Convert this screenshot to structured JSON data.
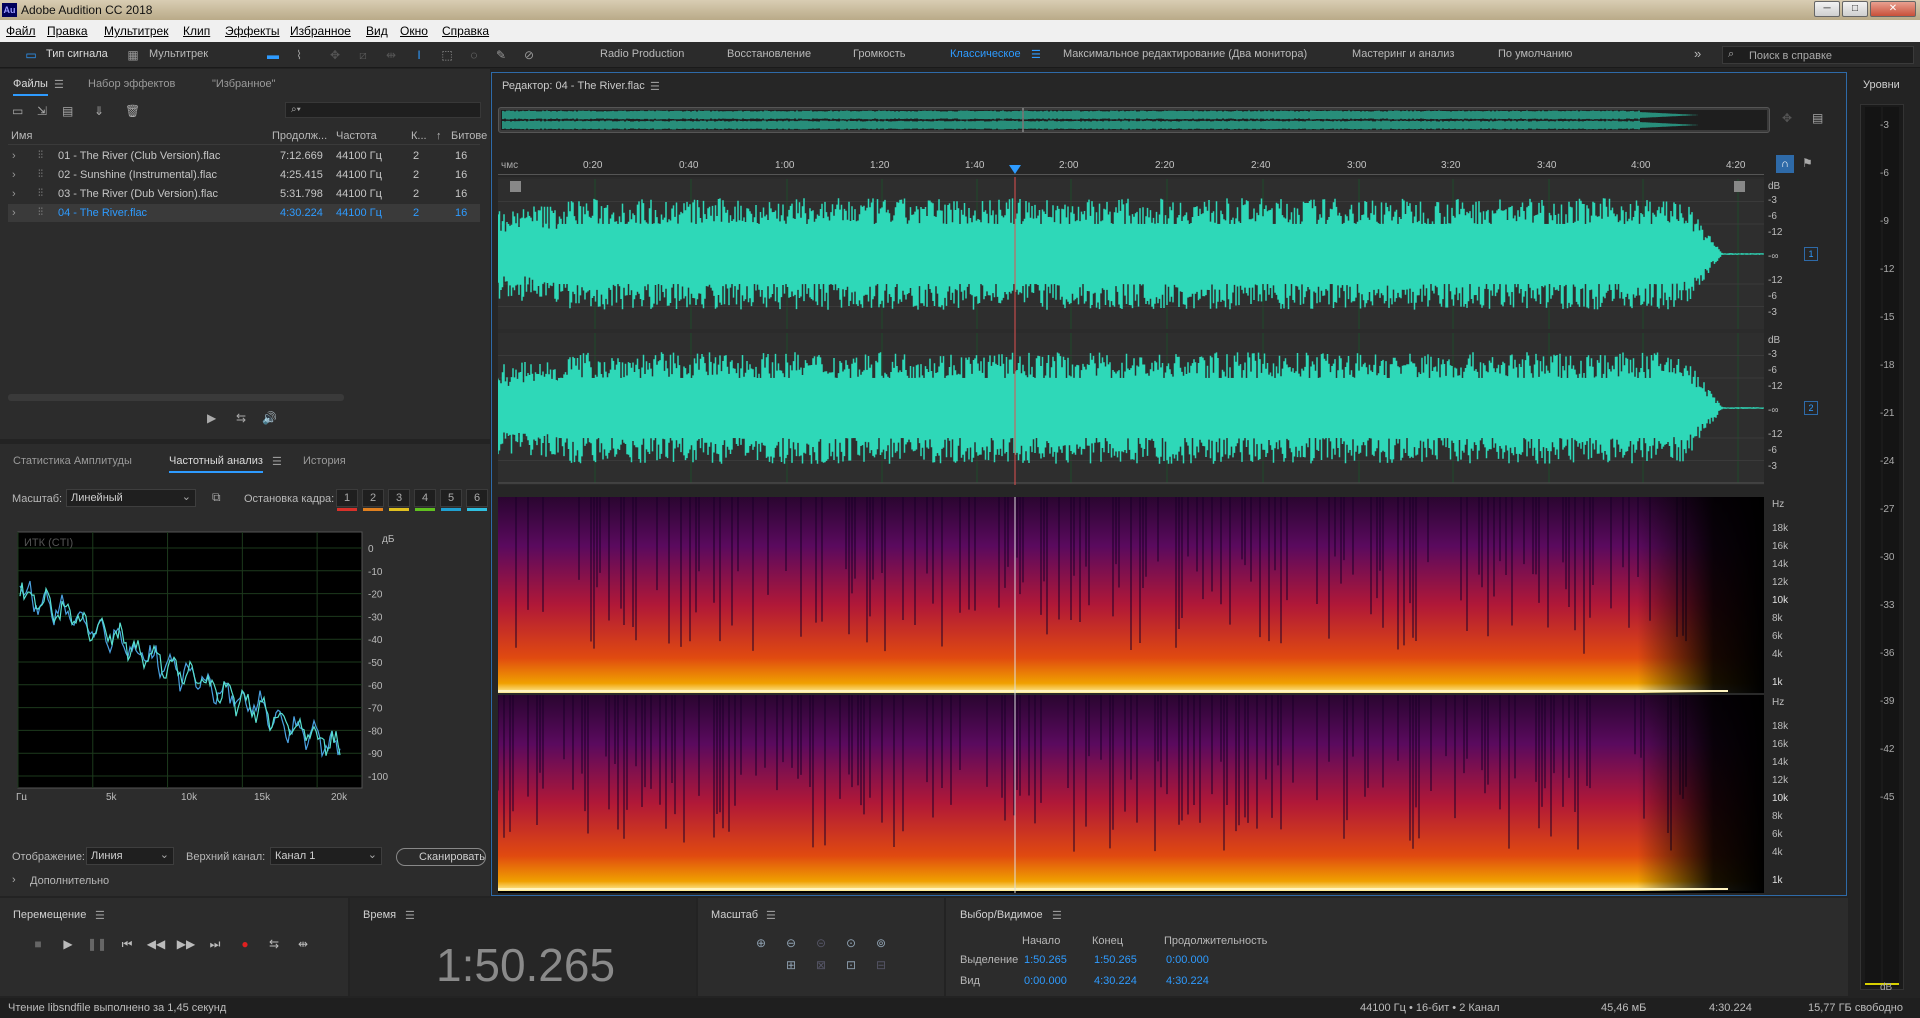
{
  "app": {
    "title": "Adobe Audition CC 2018",
    "logo": "Au"
  },
  "window_buttons": [
    "─",
    "□",
    "✕"
  ],
  "menu": [
    "Файл",
    "Правка",
    "Мультитрек",
    "Клип",
    "Эффекты",
    "Избранное",
    "Вид",
    "Окно",
    "Справка"
  ],
  "toolbar": {
    "waveform_tab": "Тип сигнала",
    "multitrack_tab": "Мультитрек",
    "workspaces": [
      "Radio Production",
      "Восстановление",
      "Громкость",
      "Классическое",
      "Максимальное редактирование (Два монитора)",
      "Мастеринг и анализ",
      "По умолчанию"
    ],
    "active_workspace": "Классическое",
    "more": "»",
    "search_placeholder": "Поиск в справке"
  },
  "files_panel": {
    "tabs": [
      "Файлы",
      "Набор эффектов",
      "\"Избранное\""
    ],
    "search_icon": "⌕▾",
    "columns": [
      "Имя",
      "Продолж...",
      "Частота",
      "К...",
      "Битове"
    ],
    "rows": [
      {
        "name": "01 - The River (Club Version).flac",
        "duration": "7:12.669",
        "rate": "44100 Гц",
        "ch": "2",
        "bits": "16"
      },
      {
        "name": "02 - Sunshine (Instrumental).flac",
        "duration": "4:25.415",
        "rate": "44100 Гц",
        "ch": "2",
        "bits": "16"
      },
      {
        "name": "03 - The River (Dub Version).flac",
        "duration": "5:31.798",
        "rate": "44100 Гц",
        "ch": "2",
        "bits": "16"
      },
      {
        "name": "04 - The River.flac",
        "duration": "4:30.224",
        "rate": "44100 Гц",
        "ch": "2",
        "bits": "16"
      }
    ],
    "selected": 3
  },
  "freq_panel": {
    "tabs": [
      "Статистика Амплитуды",
      "Частотный анализ",
      "История"
    ],
    "scale_label": "Масштаб:",
    "scale_value": "Линейный",
    "freeze_label": "Остановка кадра:",
    "freeze_buttons": [
      "1",
      "2",
      "3",
      "4",
      "5",
      "6"
    ],
    "freeze_colors": [
      "#d8312a",
      "#e08020",
      "#e0c020",
      "#60c020",
      "#20a0d0",
      "#30c0e0"
    ],
    "cti_label": "ИТК (CTI)",
    "db_unit": "дБ",
    "db_ticks": [
      "0",
      "-10",
      "-20",
      "-30",
      "-40",
      "-50",
      "-60",
      "-70",
      "-80",
      "-90",
      "-100"
    ],
    "freq_ticks": [
      "Гц",
      "5k",
      "10k",
      "15k",
      "20k"
    ],
    "display_label": "Отображение:",
    "display_value": "Линия",
    "channel_label": "Верхний канал:",
    "channel_value": "Канал 1",
    "scan_button": "Сканировать",
    "advanced": "Дополнительно"
  },
  "editor": {
    "title": "Редактор: 04 - The River.flac",
    "time_unit": "чмс",
    "ruler": [
      "0:20",
      "0:40",
      "1:00",
      "1:20",
      "1:40",
      "2:00",
      "2:20",
      "2:40",
      "3:00",
      "3:20",
      "3:40",
      "4:00",
      "4:20"
    ],
    "db_scale": [
      "dB",
      "-3",
      "-6",
      "-12",
      "-∞",
      "-12",
      "-6",
      "-3"
    ],
    "channels": [
      "1",
      "2"
    ],
    "hz_scale": [
      "Hz",
      "18k",
      "16k",
      "14k",
      "12k",
      "10k",
      "8k",
      "6k",
      "4k",
      "1k"
    ]
  },
  "levels": {
    "title": "Уровни",
    "ticks": [
      "-3",
      "-6",
      "-9",
      "-12",
      "-15",
      "-18",
      "-21",
      "-24",
      "-27",
      "-30",
      "-33",
      "-36",
      "-39",
      "-42",
      "-45",
      "dB"
    ]
  },
  "transport": {
    "title": "Перемещение"
  },
  "time": {
    "title": "Время",
    "value": "1:50.265"
  },
  "zoom": {
    "title": "Масштаб"
  },
  "selection": {
    "title": "Выбор/Видимое",
    "cols": [
      "Начало",
      "Конец",
      "Продолжительность"
    ],
    "rows": [
      {
        "label": "Выделение",
        "start": "1:50.265",
        "end": "1:50.265",
        "dur": "0:00.000"
      },
      {
        "label": "Вид",
        "start": "0:00.000",
        "end": "4:30.224",
        "dur": "4:30.224"
      }
    ]
  },
  "status": {
    "left": "Чтение libsndfile выполнено за 1,45 секунд",
    "format": "44100 Гц • 16-бит • 2 Канал",
    "size": "45,46 мБ",
    "duration": "4:30.224",
    "free": "15,77 ГБ свободно"
  }
}
